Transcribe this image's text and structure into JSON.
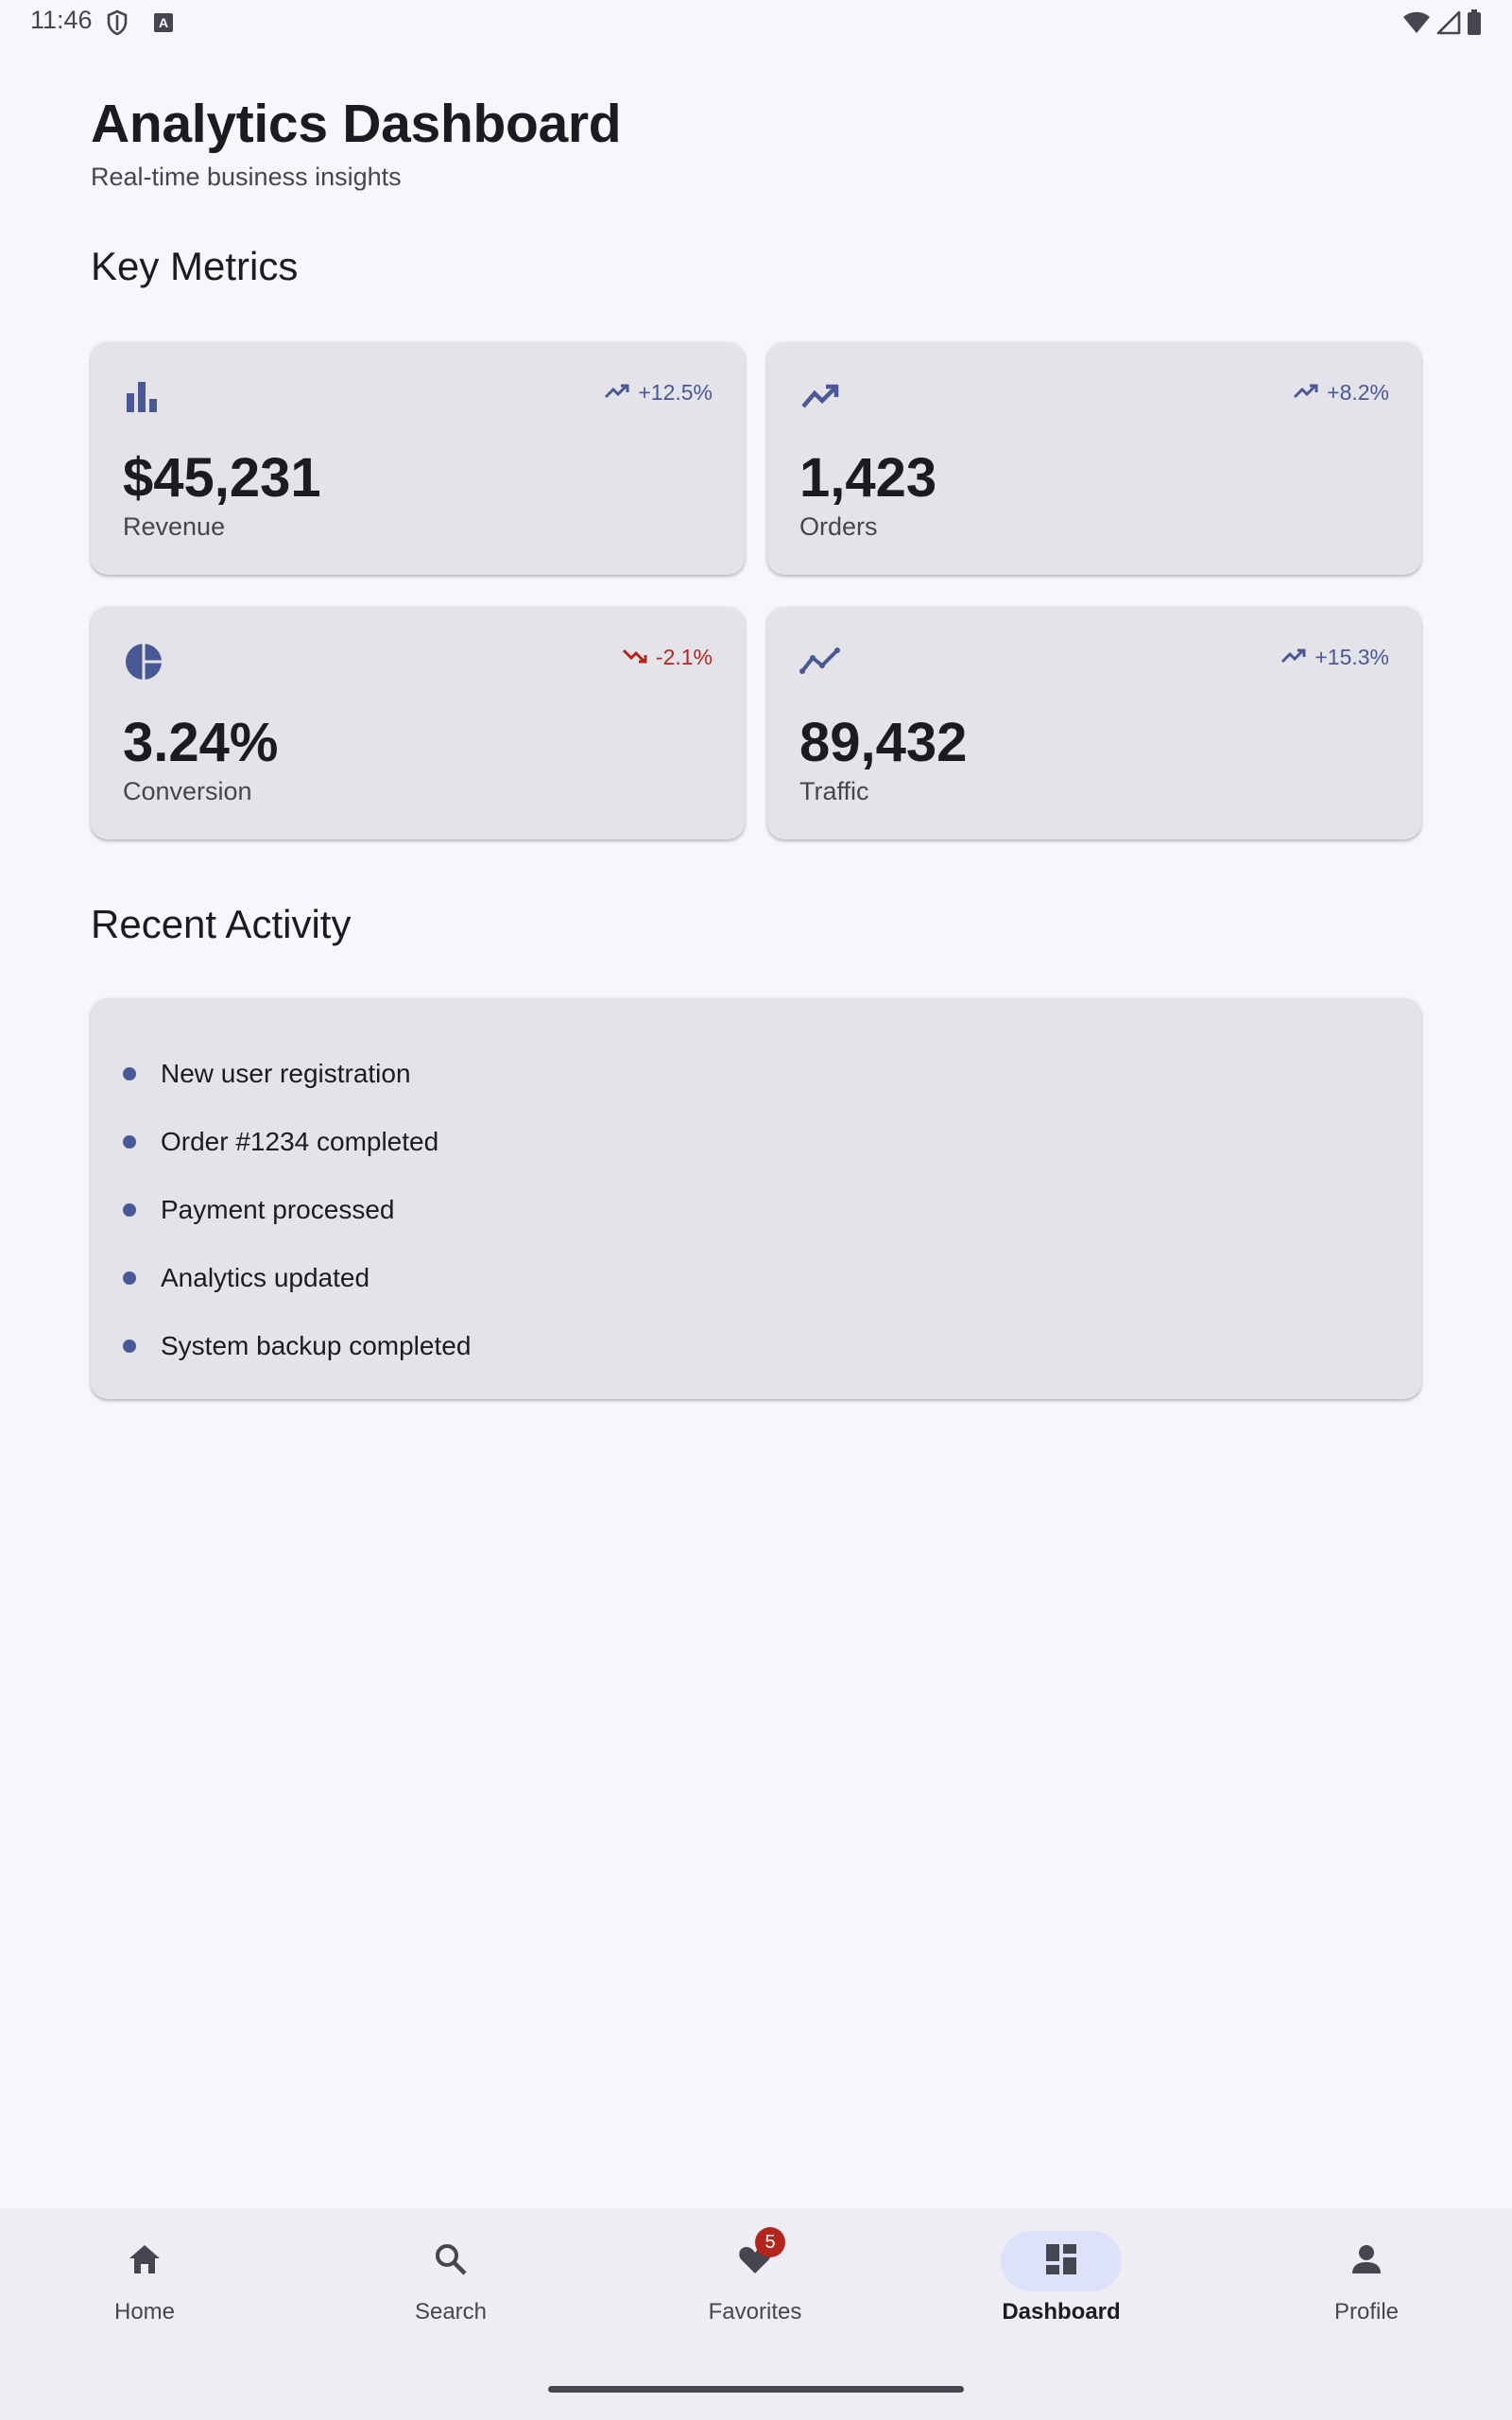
{
  "status_bar": {
    "time": "11:46",
    "left_icons": [
      "shield-icon",
      "keyboard-a-icon"
    ],
    "right_icons": [
      "wifi-icon",
      "cellular-icon",
      "battery-icon"
    ]
  },
  "header": {
    "title": "Analytics Dashboard",
    "subtitle": "Real-time business insights"
  },
  "sections": {
    "key_metrics": "Key Metrics",
    "recent_activity": "Recent Activity"
  },
  "metrics": {
    "revenue": {
      "icon": "bar-chart-icon",
      "trend": "+12.5%",
      "trend_direction": "up",
      "value": "$45,231",
      "label": "Revenue"
    },
    "orders": {
      "icon": "trending-up-icon",
      "trend": "+8.2%",
      "trend_direction": "up",
      "value": "1,423",
      "label": "Orders"
    },
    "conversion": {
      "icon": "pie-chart-icon",
      "trend": "-2.1%",
      "trend_direction": "down",
      "value": "3.24%",
      "label": "Conversion"
    },
    "traffic": {
      "icon": "show-chart-icon",
      "trend": "+15.3%",
      "trend_direction": "up",
      "value": "89,432",
      "label": "Traffic"
    }
  },
  "activity": [
    "New user registration",
    "Order #1234 completed",
    "Payment processed",
    "Analytics updated",
    "System backup completed"
  ],
  "bottom_nav": {
    "items": [
      {
        "label": "Home",
        "icon": "home-icon"
      },
      {
        "label": "Search",
        "icon": "search-icon"
      },
      {
        "label": "Favorites",
        "icon": "heart-icon",
        "badge": "5"
      },
      {
        "label": "Dashboard",
        "icon": "dashboard-icon",
        "active": true
      },
      {
        "label": "Profile",
        "icon": "person-icon"
      }
    ]
  },
  "colors": {
    "background": "#f7f6fc",
    "card": "#e4e3e9",
    "accent": "#4a5995",
    "negative": "#b3261e",
    "nav_active_pill": "#dde1f9"
  }
}
